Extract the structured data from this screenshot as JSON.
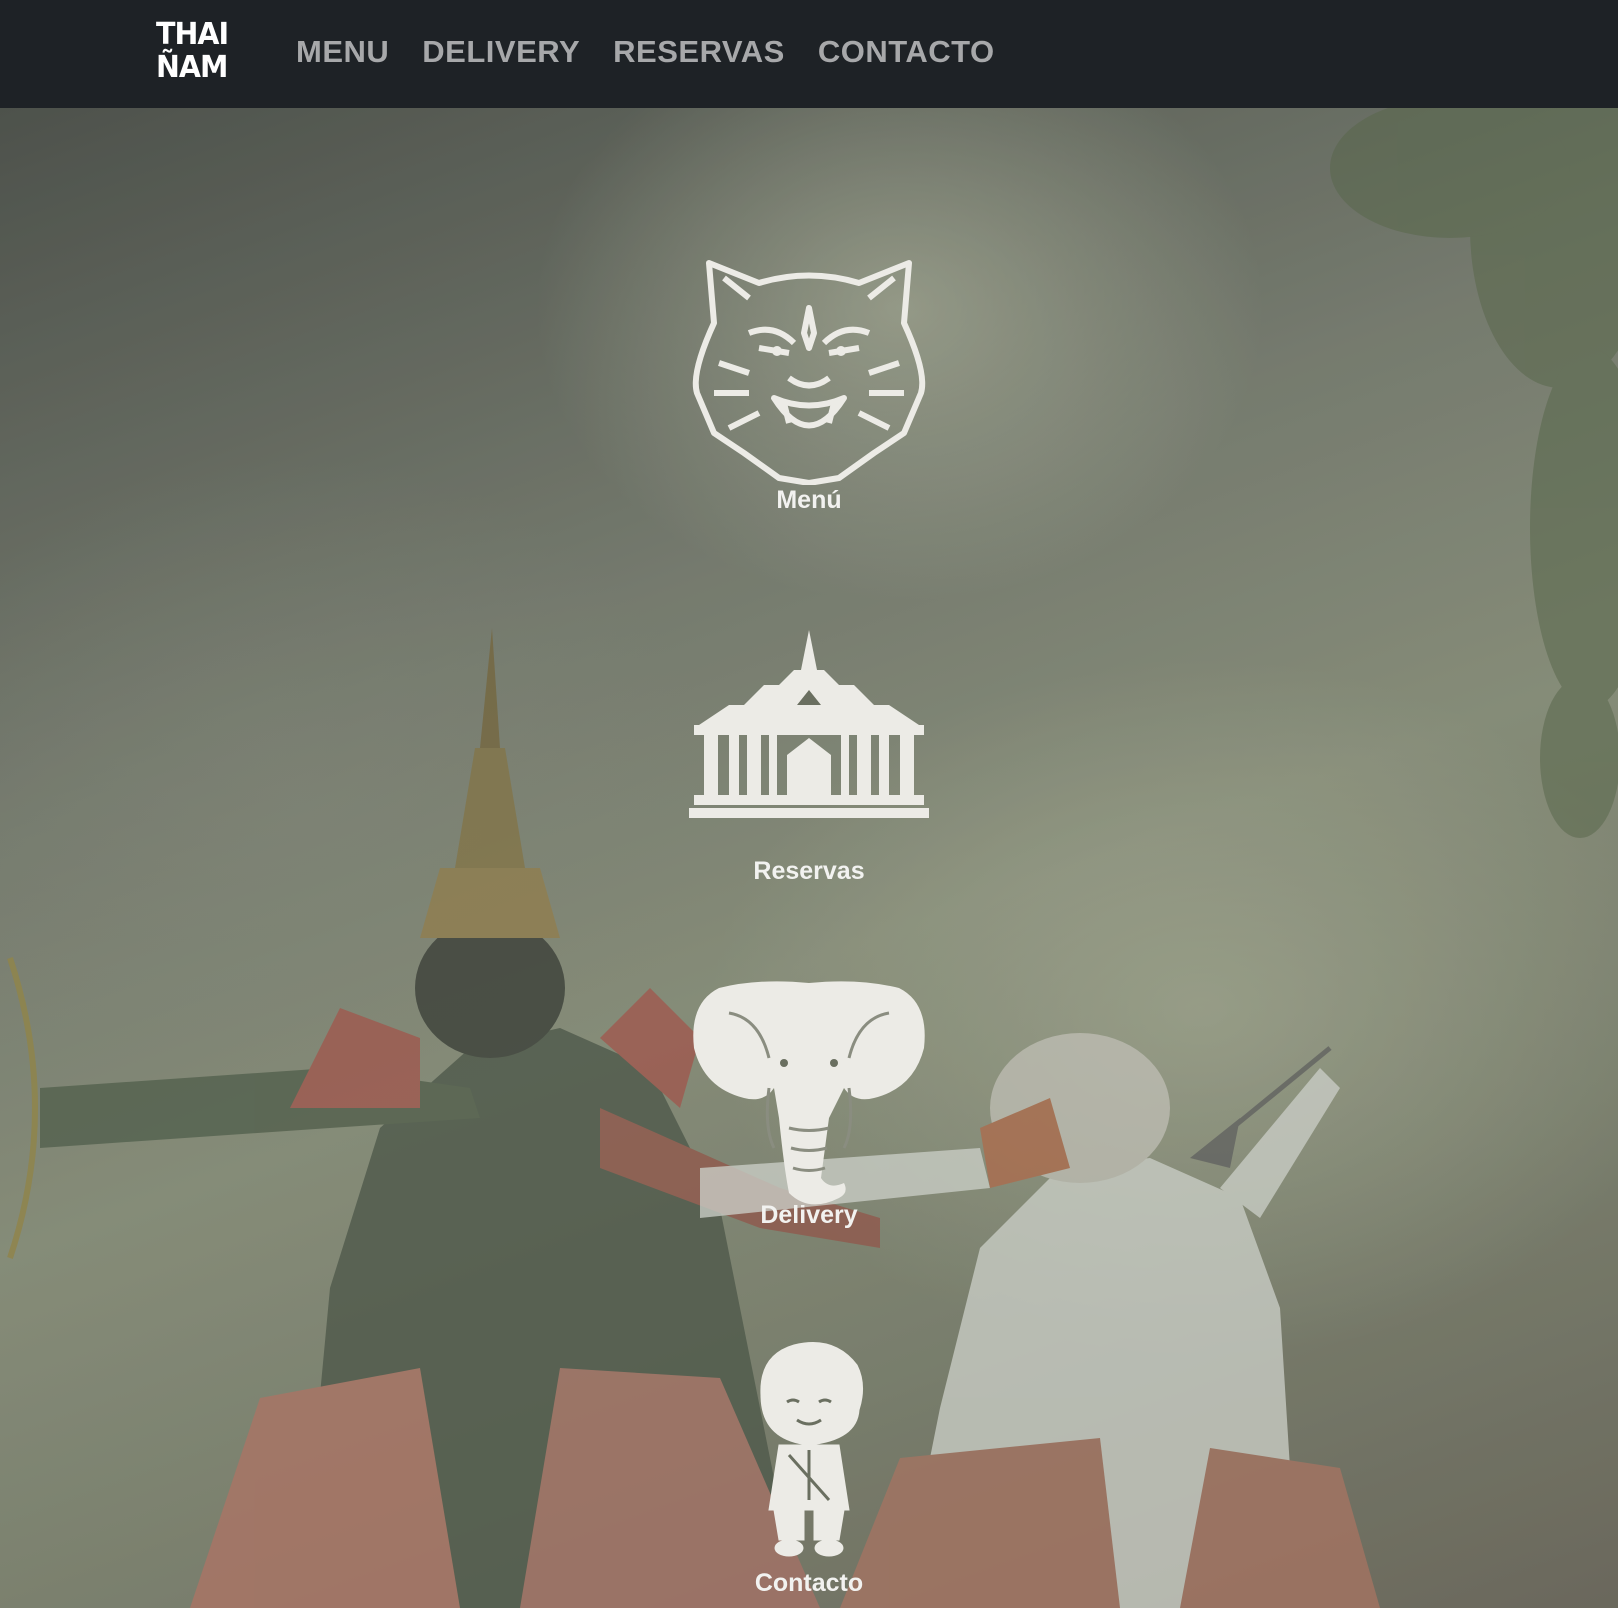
{
  "header": {
    "logo_line1": "THAI",
    "logo_line2": "ÑAM",
    "links": [
      {
        "label": "MENU"
      },
      {
        "label": "DELIVERY"
      },
      {
        "label": "RESERVAS"
      },
      {
        "label": "CONTACTO"
      }
    ]
  },
  "hero": {
    "items": [
      {
        "label": "Menú",
        "icon": "tiger-icon"
      },
      {
        "label": "Reservas",
        "icon": "temple-icon"
      },
      {
        "label": "Delivery",
        "icon": "elephant-icon"
      },
      {
        "label": "Contacto",
        "icon": "person-icon"
      }
    ]
  },
  "colors": {
    "navbar": "#1e2226",
    "nav_text": "#a7a8aa",
    "icon": "#ecebe6"
  }
}
